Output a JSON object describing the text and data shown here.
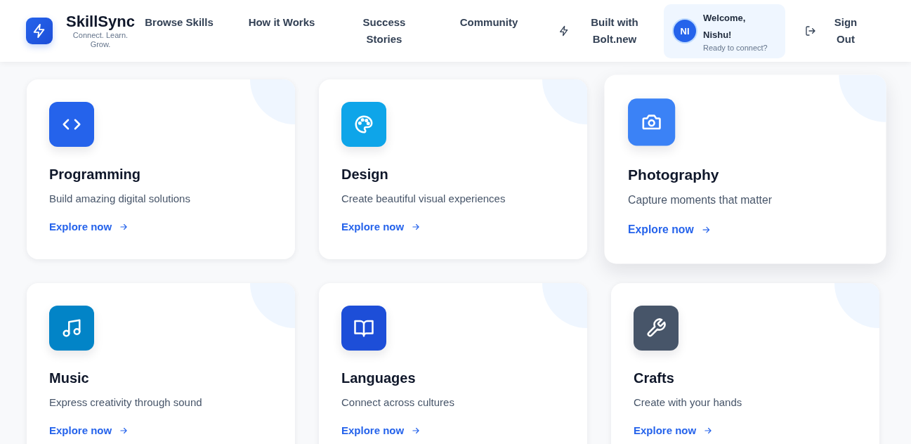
{
  "header": {
    "brand": {
      "name": "SkillSync",
      "tagline": "Connect. Learn. Grow."
    },
    "nav": [
      {
        "label": "Browse Skills"
      },
      {
        "label": "How it Works"
      },
      {
        "label": "Success Stories"
      },
      {
        "label": "Community"
      }
    ],
    "built_with": "Built with Bolt.new",
    "user": {
      "initials": "NI",
      "greeting": "Welcome, Nishu!",
      "status": "Ready to connect?"
    },
    "sign_out": "Sign Out"
  },
  "categories": [
    {
      "title": "Programming",
      "description": "Build amazing digital solutions",
      "link": "Explore now",
      "color": "#2563eb",
      "hovered": false
    },
    {
      "title": "Design",
      "description": "Create beautiful visual experiences",
      "link": "Explore now",
      "color": "#0ea5e9",
      "hovered": false
    },
    {
      "title": "Photography",
      "description": "Capture moments that matter",
      "link": "Explore now",
      "color": "#3b82f6",
      "hovered": true
    },
    {
      "title": "Music",
      "description": "Express creativity through sound",
      "link": "Explore now",
      "color": "#0284c7",
      "hovered": false
    },
    {
      "title": "Languages",
      "description": "Connect across cultures",
      "link": "Explore now",
      "color": "#1d4ed8",
      "hovered": false
    },
    {
      "title": "Crafts",
      "description": "Create with your hands",
      "link": "Explore now",
      "color": "#475569",
      "hovered": false
    }
  ]
}
